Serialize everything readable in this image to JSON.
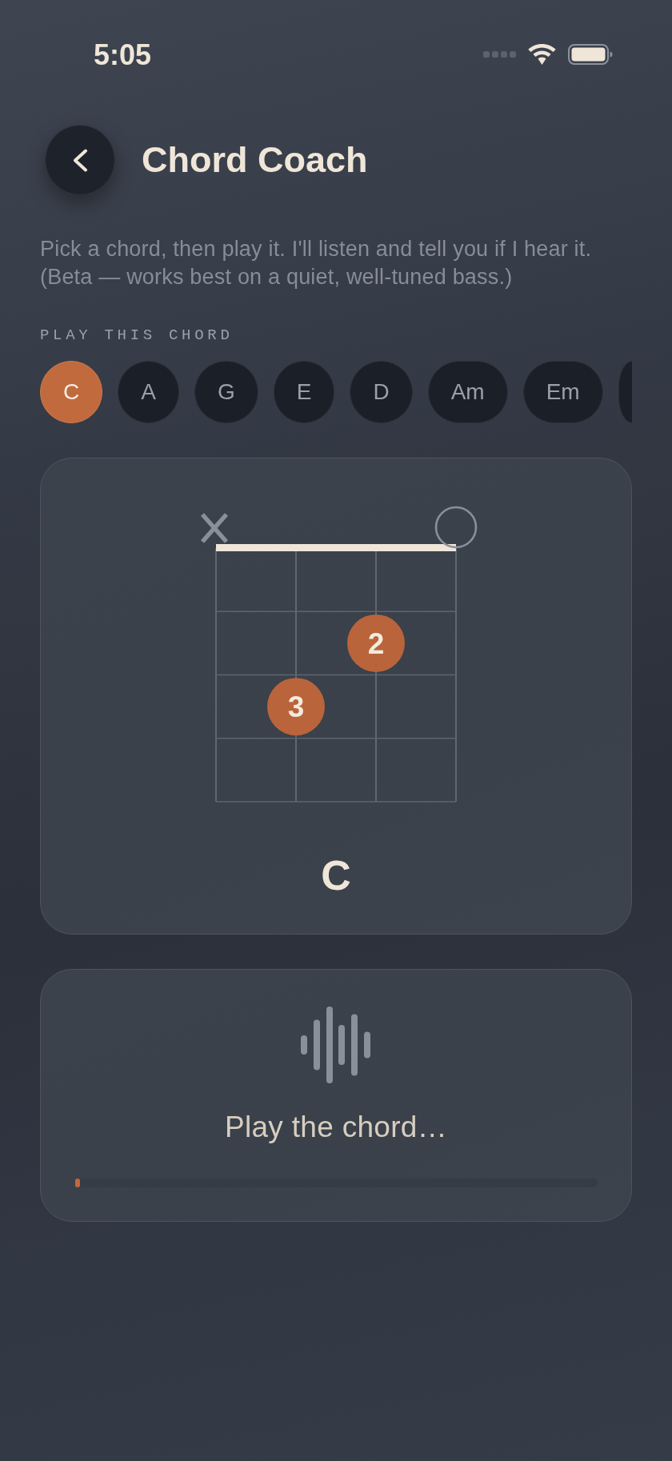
{
  "status_bar": {
    "time": "5:05"
  },
  "header": {
    "title": "Chord Coach"
  },
  "intro": {
    "text": "Pick a chord, then play it. I'll listen and tell you if I hear it.",
    "note": "(Beta — works best on a quiet, well-tuned bass.)"
  },
  "chord_picker": {
    "label": "PLAY THIS CHORD",
    "chords": [
      {
        "kind": "full",
        "label": "C",
        "selected": true
      },
      {
        "kind": "full",
        "label": "A",
        "selected": false
      },
      {
        "kind": "full",
        "label": "G",
        "selected": false
      },
      {
        "kind": "full",
        "label": "E",
        "selected": false
      },
      {
        "kind": "full",
        "label": "D",
        "selected": false
      },
      {
        "kind": "full",
        "label": "Am",
        "selected": false
      },
      {
        "kind": "full",
        "label": "Em",
        "selected": false
      },
      {
        "kind": "cut",
        "selected": false
      }
    ]
  },
  "diagram": {
    "strings": [
      {
        "kind": "muted",
        "frets": [
          {
            "kind": "empty"
          },
          {
            "kind": "empty"
          },
          {
            "kind": "empty"
          },
          {
            "kind": "empty"
          }
        ]
      },
      {
        "kind": "fretted",
        "frets": [
          {
            "kind": "empty"
          },
          {
            "kind": "empty"
          },
          {
            "kind": "finger",
            "label": "3"
          },
          {
            "kind": "empty"
          }
        ]
      },
      {
        "kind": "fretted",
        "frets": [
          {
            "kind": "empty"
          },
          {
            "kind": "finger",
            "label": "2"
          },
          {
            "kind": "empty"
          },
          {
            "kind": "empty"
          }
        ]
      },
      {
        "kind": "open",
        "frets": [
          {
            "kind": "empty"
          },
          {
            "kind": "empty"
          },
          {
            "kind": "empty"
          },
          {
            "kind": "empty"
          }
        ]
      }
    ],
    "chord_name": "C"
  },
  "listener": {
    "status": "Play the chord…",
    "level": 0.01
  }
}
